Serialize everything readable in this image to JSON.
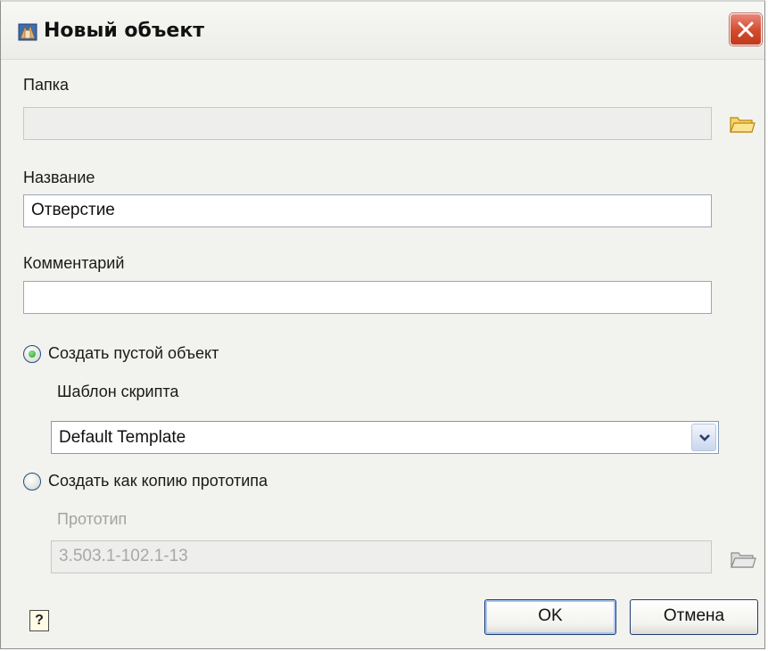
{
  "window": {
    "title": "Новый объект",
    "close_symbol": "✕"
  },
  "folder": {
    "label": "Папка",
    "value": "",
    "browse_icon": "folder-icon"
  },
  "name": {
    "label": "Название",
    "value": "Отверстие"
  },
  "comment": {
    "label": "Комментарий",
    "value": ""
  },
  "create_empty": {
    "label": "Создать пустой объект",
    "selected": true,
    "template_label": "Шаблон скрипта",
    "template_value": "Default Template"
  },
  "create_copy": {
    "label": "Создать как копию прототипа",
    "selected": false,
    "prototype_label": "Прототип",
    "prototype_value": "3.503.1-102.1-13"
  },
  "buttons": {
    "help": "?",
    "ok": "OK",
    "cancel": "Отмена"
  },
  "colors": {
    "close_button": "#d34a2c",
    "radio_dot": "#20a020",
    "folder": "#f5c542"
  }
}
